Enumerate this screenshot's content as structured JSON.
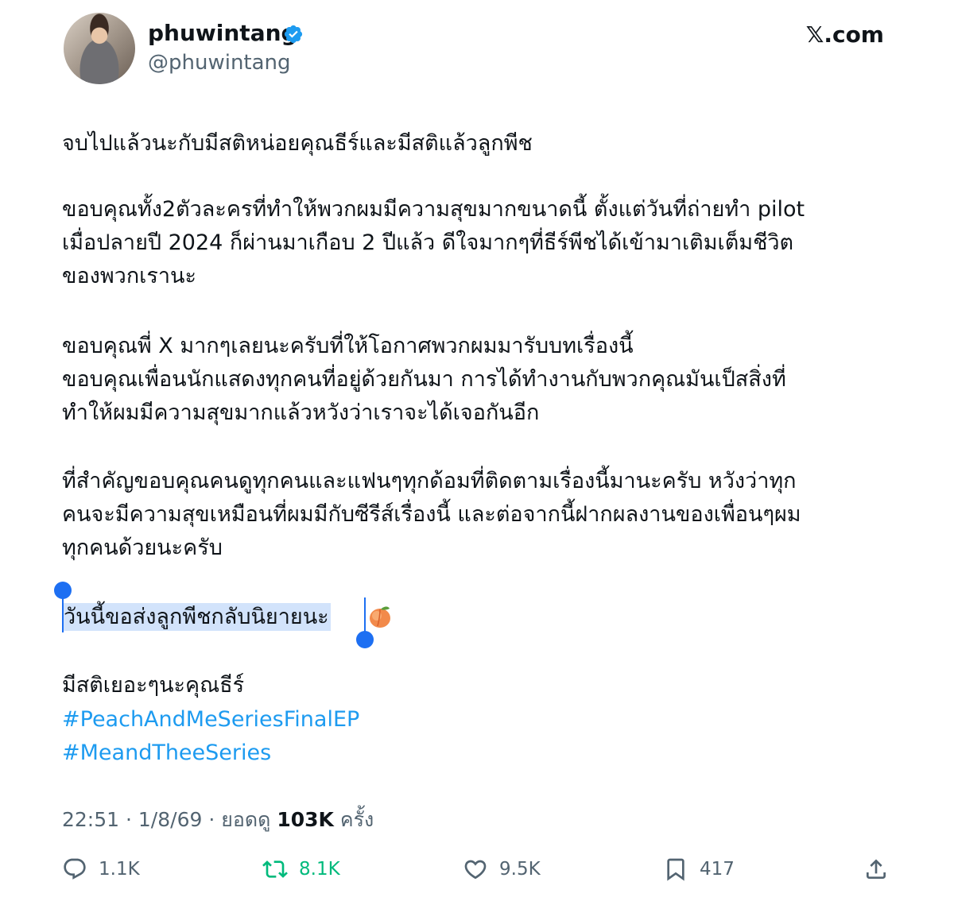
{
  "author": {
    "name": "phuwintang",
    "handle": "@phuwintang"
  },
  "site": "𝕏.com",
  "tweet": {
    "paragraphs": [
      [
        "จบไปแล้วนะกับมีสติหน่อยคุณธีร์และมีสติแล้วลูกพีช"
      ],
      [
        "ขอบคุณทั้ง2ตัวละครที่ทำให้พวกผมมีความสุขมากขนาดนี้ ตั้งแต่วันที่ถ่ายทำ pilot",
        "เมื่อปลายปี 2024 ก็ผ่านมาเกือบ 2 ปีแล้ว ดีใจมากๆที่ธีร์พีชได้เข้ามาเติมเต็มชีวิต",
        "ของพวกเรานะ"
      ],
      [
        "ขอบคุณพี่ X มากๆเลยนะครับที่ให้โอกาศพวกผมมารับบทเรื่องนี้",
        "ขอบคุณเพื่อนนักแสดงทุกคนที่อยู่ด้วยกันมา การได้ทำงานกับพวกคุณมันเป็สสิ่งที่",
        "ทำให้ผมมีความสุขมากแล้วหวังว่าเราจะได้เจอกันอีก"
      ],
      [
        "ที่สำคัญขอบคุณคนดูทุกคนและแฟนๆทุกด้อมที่ติดตามเรื่องนี้มานะครับ หวังว่าทุก",
        "คนจะมีความสุขเหมือนที่ผมมีกับซีรีส์เรื่องนี้ และต่อจากนี้ฝากผลงานของเพื่อนๆผม",
        "ทุกคนด้วยนะครับ"
      ]
    ],
    "highlighted_line": "วันนี้ขอส่งลูกพีชกลับนิยายนะ",
    "closing_line": "มีสติเยอะๆนะคุณธีร์",
    "hashtags": [
      "#PeachAndMeSeriesFinalEP",
      "#MeandTheeSeries"
    ]
  },
  "meta": {
    "time": "22:51",
    "date": "1/8/69",
    "views_label": "ยอดดู",
    "views": "103K",
    "views_suffix": "ครั้ง"
  },
  "actions": {
    "replies": "1.1K",
    "reposts": "8.1K",
    "likes": "9.5K",
    "bookmarks": "417"
  },
  "colors": {
    "link": "#1d9bf0",
    "repost": "#00ba7c",
    "selection": "#d2e3fb",
    "selection_handle": "#1d6ff2",
    "secondary_text": "#536471"
  },
  "icons": [
    "verified-badge-icon",
    "peach-emoji-icon",
    "reply-icon",
    "repost-icon",
    "like-icon",
    "bookmark-icon",
    "share-icon"
  ]
}
